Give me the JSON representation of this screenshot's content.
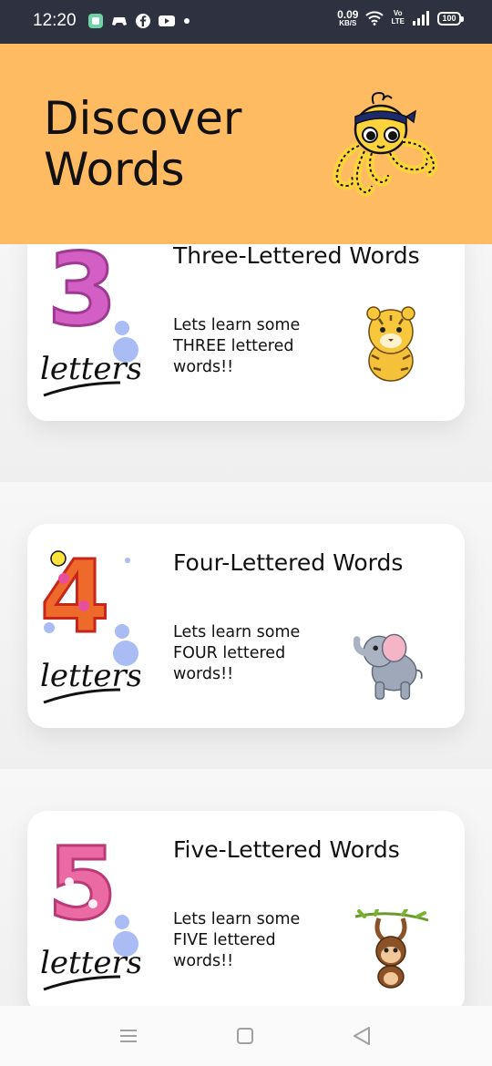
{
  "status_bar": {
    "time": "12:20",
    "net_speed_value": "0.09",
    "net_speed_unit": "KB/S",
    "volte_top": "Vo",
    "volte_bottom": "LTE",
    "battery": "100"
  },
  "header": {
    "title_line1": "Discover",
    "title_line2": "Words",
    "mascot_icon": "octopus-mascot-icon",
    "background_color": "#ffbb62"
  },
  "cards": [
    {
      "number": "3",
      "letters_text": "letters",
      "title": "Three-Lettered Words",
      "description": "Lets learn some THREE lettered words!!",
      "animal_icon": "tiger-icon",
      "number_color": "#d35fc4"
    },
    {
      "number": "4",
      "letters_text": "letters",
      "title": "Four-Lettered Words",
      "description": "Lets learn some FOUR lettered words!!",
      "animal_icon": "elephant-icon",
      "number_color": "#ee6a2a"
    },
    {
      "number": "5",
      "letters_text": "letters",
      "title": "Five-Lettered Words",
      "description": "Lets learn some FIVE lettered words!!",
      "animal_icon": "monkey-icon",
      "number_color": "#ec6aa3"
    }
  ],
  "nav": {
    "menu_icon": "menu-icon",
    "home_icon": "home-square-icon",
    "back_icon": "back-triangle-icon"
  }
}
